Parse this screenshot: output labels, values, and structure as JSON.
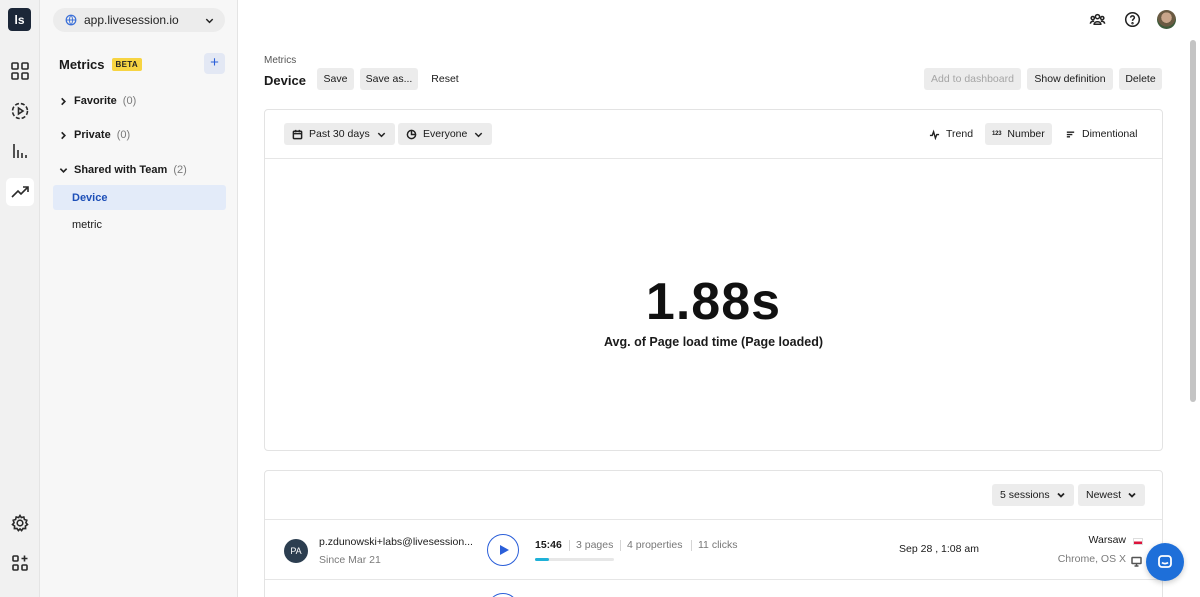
{
  "rail": {
    "logo": "ls",
    "items": [
      "dashboard-icon",
      "sessions-play-icon",
      "bar-chart-icon",
      "trend-icon",
      "settings-gear-icon",
      "integrations-icon"
    ]
  },
  "sidebar": {
    "site": "app.livesession.io",
    "title": "Metrics",
    "badge": "BETA",
    "add_label": "+",
    "folders": [
      {
        "label": "Favorite",
        "count": "(0)"
      },
      {
        "label": "Private",
        "count": "(0)"
      },
      {
        "label": "Shared with Team",
        "count": "(2)"
      }
    ],
    "metrics": [
      "Device",
      "metric"
    ]
  },
  "header": {
    "breadcrumb": "Metrics",
    "title": "Device",
    "save": "Save",
    "save_as": "Save as...",
    "reset": "Reset",
    "add_to_dashboard": "Add to dashboard",
    "show_definition": "Show definition",
    "delete": "Delete"
  },
  "toolbar": {
    "date_range": "Past 30 days",
    "segment": "Everyone",
    "view_trend": "Trend",
    "view_number": "Number",
    "view_number_icon": "123",
    "view_dimensional": "Dimentional",
    "active_view": "Number"
  },
  "metric": {
    "value": "1.88s",
    "caption": "Avg. of Page load time (Page loaded)"
  },
  "sessions": {
    "count_label": "5 sessions",
    "sort_label": "Newest",
    "rows": [
      {
        "initials": "PA",
        "email": "p.zdunowski+labs@livesession...",
        "since": "Since Mar 21",
        "duration": "15:46",
        "pages": "3 pages",
        "properties": "4 properties",
        "clicks": "11 clicks",
        "progress": 0.18,
        "date": "Sep 28 , 1:08 am",
        "city": "Warsaw",
        "browser": "Chrome, OS X"
      }
    ]
  },
  "colors": {
    "accent": "#2b5fd9",
    "beta_badge": "#f7d442",
    "active_item_bg": "#e3ebf9",
    "progress": "#1fb1d8",
    "chat": "#1e6fd9"
  }
}
